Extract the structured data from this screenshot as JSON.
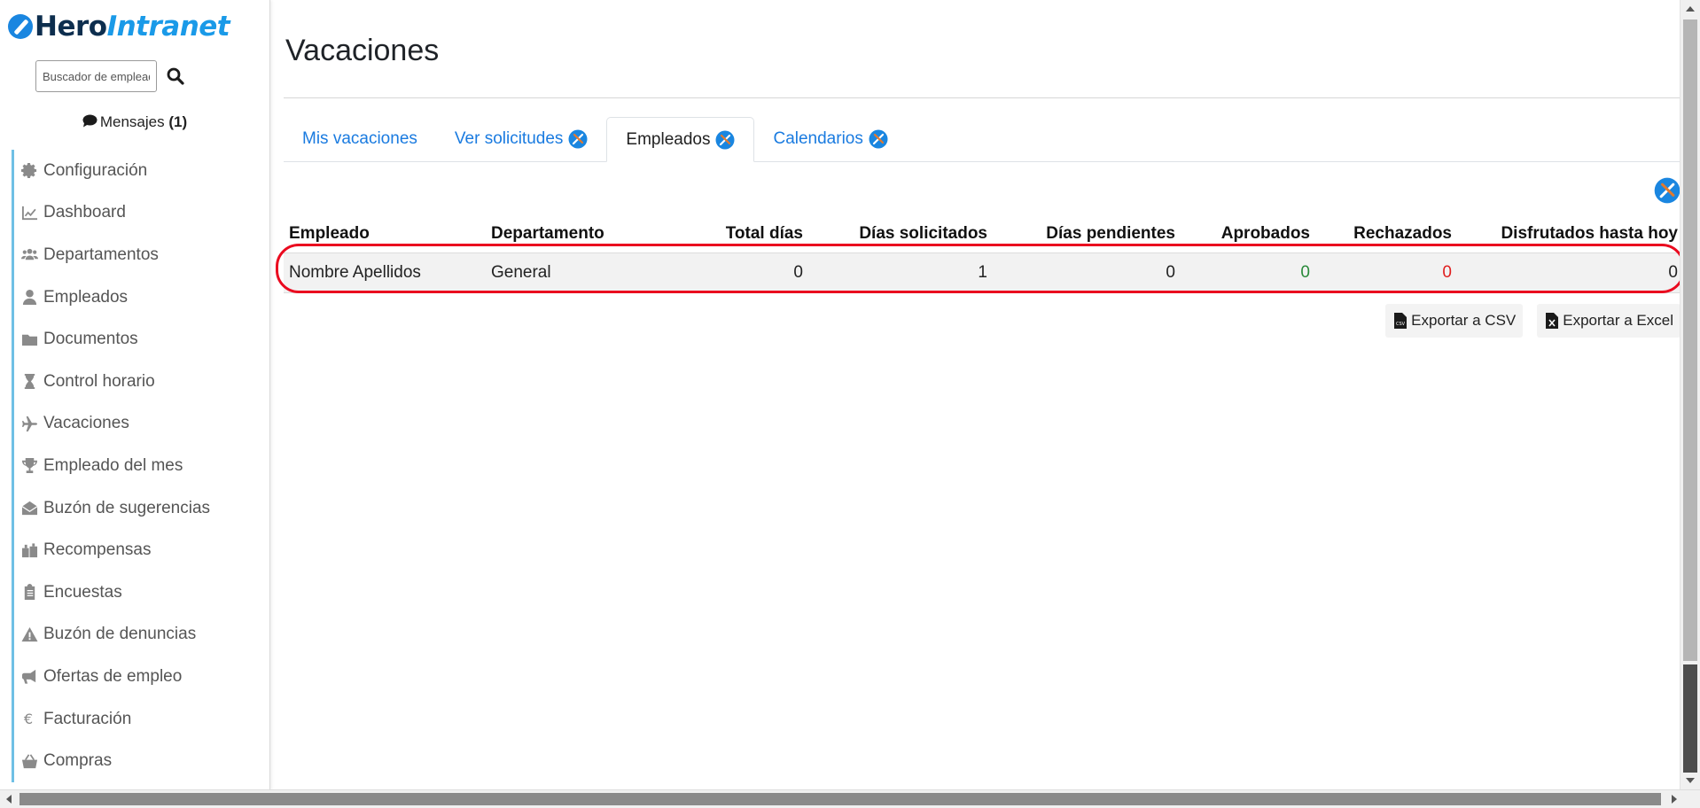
{
  "brand": {
    "part1": "Hero",
    "part2": "Intranet"
  },
  "search": {
    "placeholder": "Buscador de empleados..."
  },
  "messages": {
    "label": "Mensajes",
    "count": "(1)"
  },
  "sidebar": {
    "items": [
      {
        "label": "Configuración",
        "icon": "gear-icon"
      },
      {
        "label": "Dashboard",
        "icon": "chart-line-icon"
      },
      {
        "label": "Departamentos",
        "icon": "users-icon"
      },
      {
        "label": "Empleados",
        "icon": "user-icon"
      },
      {
        "label": "Documentos",
        "icon": "folder-icon"
      },
      {
        "label": "Control horario",
        "icon": "hourglass-icon"
      },
      {
        "label": "Vacaciones",
        "icon": "plane-icon"
      },
      {
        "label": "Empleado del mes",
        "icon": "trophy-icon"
      },
      {
        "label": "Buzón de sugerencias",
        "icon": "envelope-open-icon"
      },
      {
        "label": "Recompensas",
        "icon": "gifts-icon"
      },
      {
        "label": "Encuestas",
        "icon": "clipboard-icon"
      },
      {
        "label": "Buzón de denuncias",
        "icon": "warning-icon"
      },
      {
        "label": "Ofertas de empleo",
        "icon": "megaphone-icon"
      },
      {
        "label": "Facturación",
        "icon": "euro-icon"
      },
      {
        "label": "Compras",
        "icon": "basket-icon"
      }
    ]
  },
  "page": {
    "title": "Vacaciones"
  },
  "tabs": [
    {
      "label": "Mis vacaciones",
      "active": false,
      "tool": false
    },
    {
      "label": "Ver solicitudes",
      "active": false,
      "tool": true
    },
    {
      "label": "Empleados",
      "active": true,
      "tool": true
    },
    {
      "label": "Calendarios",
      "active": false,
      "tool": true
    }
  ],
  "table": {
    "headers": [
      "Empleado",
      "Departamento",
      "Total días",
      "Días solicitados",
      "Días pendientes",
      "Aprobados",
      "Rechazados",
      "Disfrutados hasta hoy"
    ],
    "rows": [
      [
        "Nombre Apellidos",
        "General",
        "0",
        "1",
        "0",
        "0",
        "0",
        "0"
      ]
    ]
  },
  "export": {
    "csv_label": "Exportar a CSV",
    "excel_label": "Exportar a Excel"
  },
  "colors": {
    "accent": "#1a7be0",
    "approved": "#2a8a3a",
    "rejected": "#e02020",
    "highlight": "#ea0a1f"
  }
}
